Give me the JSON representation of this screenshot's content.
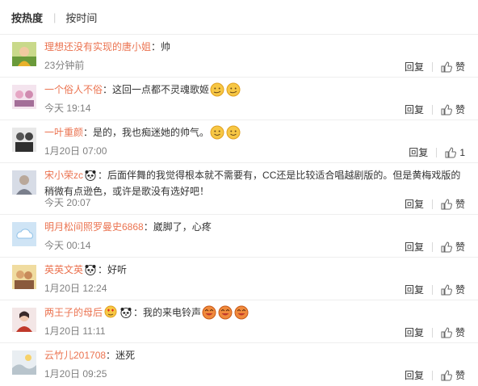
{
  "sort": {
    "hot": "按热度",
    "sep": "|",
    "time": "按时间"
  },
  "reply_label": "回复",
  "like_label": "赞",
  "colors": {
    "username": "#eb7350",
    "meta": "#808080",
    "text": "#333333"
  },
  "comments": [
    {
      "user": "理想还没有实现的唐小姐",
      "sep": "：",
      "text": "帅",
      "time": "23分钟前",
      "likes": ""
    },
    {
      "user": "一个俗人不俗",
      "sep": "：",
      "text": "这回一点都不灵魂歌姬",
      "time": "今天 19:14",
      "likes": ""
    },
    {
      "user": "一叶重颜",
      "sep": "：",
      "text": "是的，我也痴迷她的帅气。",
      "time": "1月20日 07:00",
      "likes": "1"
    },
    {
      "user": "宋小荣zc",
      "sep": "：",
      "text": "后面伴舞的我觉得根本就不需要有，CC还是比较适合唱越剧版的。但是黄梅戏版的稍微有点逊色，或许是歌没有选好吧！",
      "time": "今天 20:07",
      "likes": ""
    },
    {
      "user": "明月松间照罗曼史6868",
      "sep": "：",
      "text": "崴脚了，心疼",
      "time": "今天 00:14",
      "likes": ""
    },
    {
      "user": "英英文英",
      "sep": "：",
      "text": "好听",
      "time": "1月20日 12:24",
      "likes": ""
    },
    {
      "user": "两王子的母后",
      "sep": "：",
      "text": "我的来电铃声",
      "time": "1月20日 11:11",
      "likes": ""
    },
    {
      "user": "云竹儿201708",
      "sep": "：",
      "text": "迷死",
      "time": "1月20日 09:25",
      "likes": ""
    }
  ]
}
